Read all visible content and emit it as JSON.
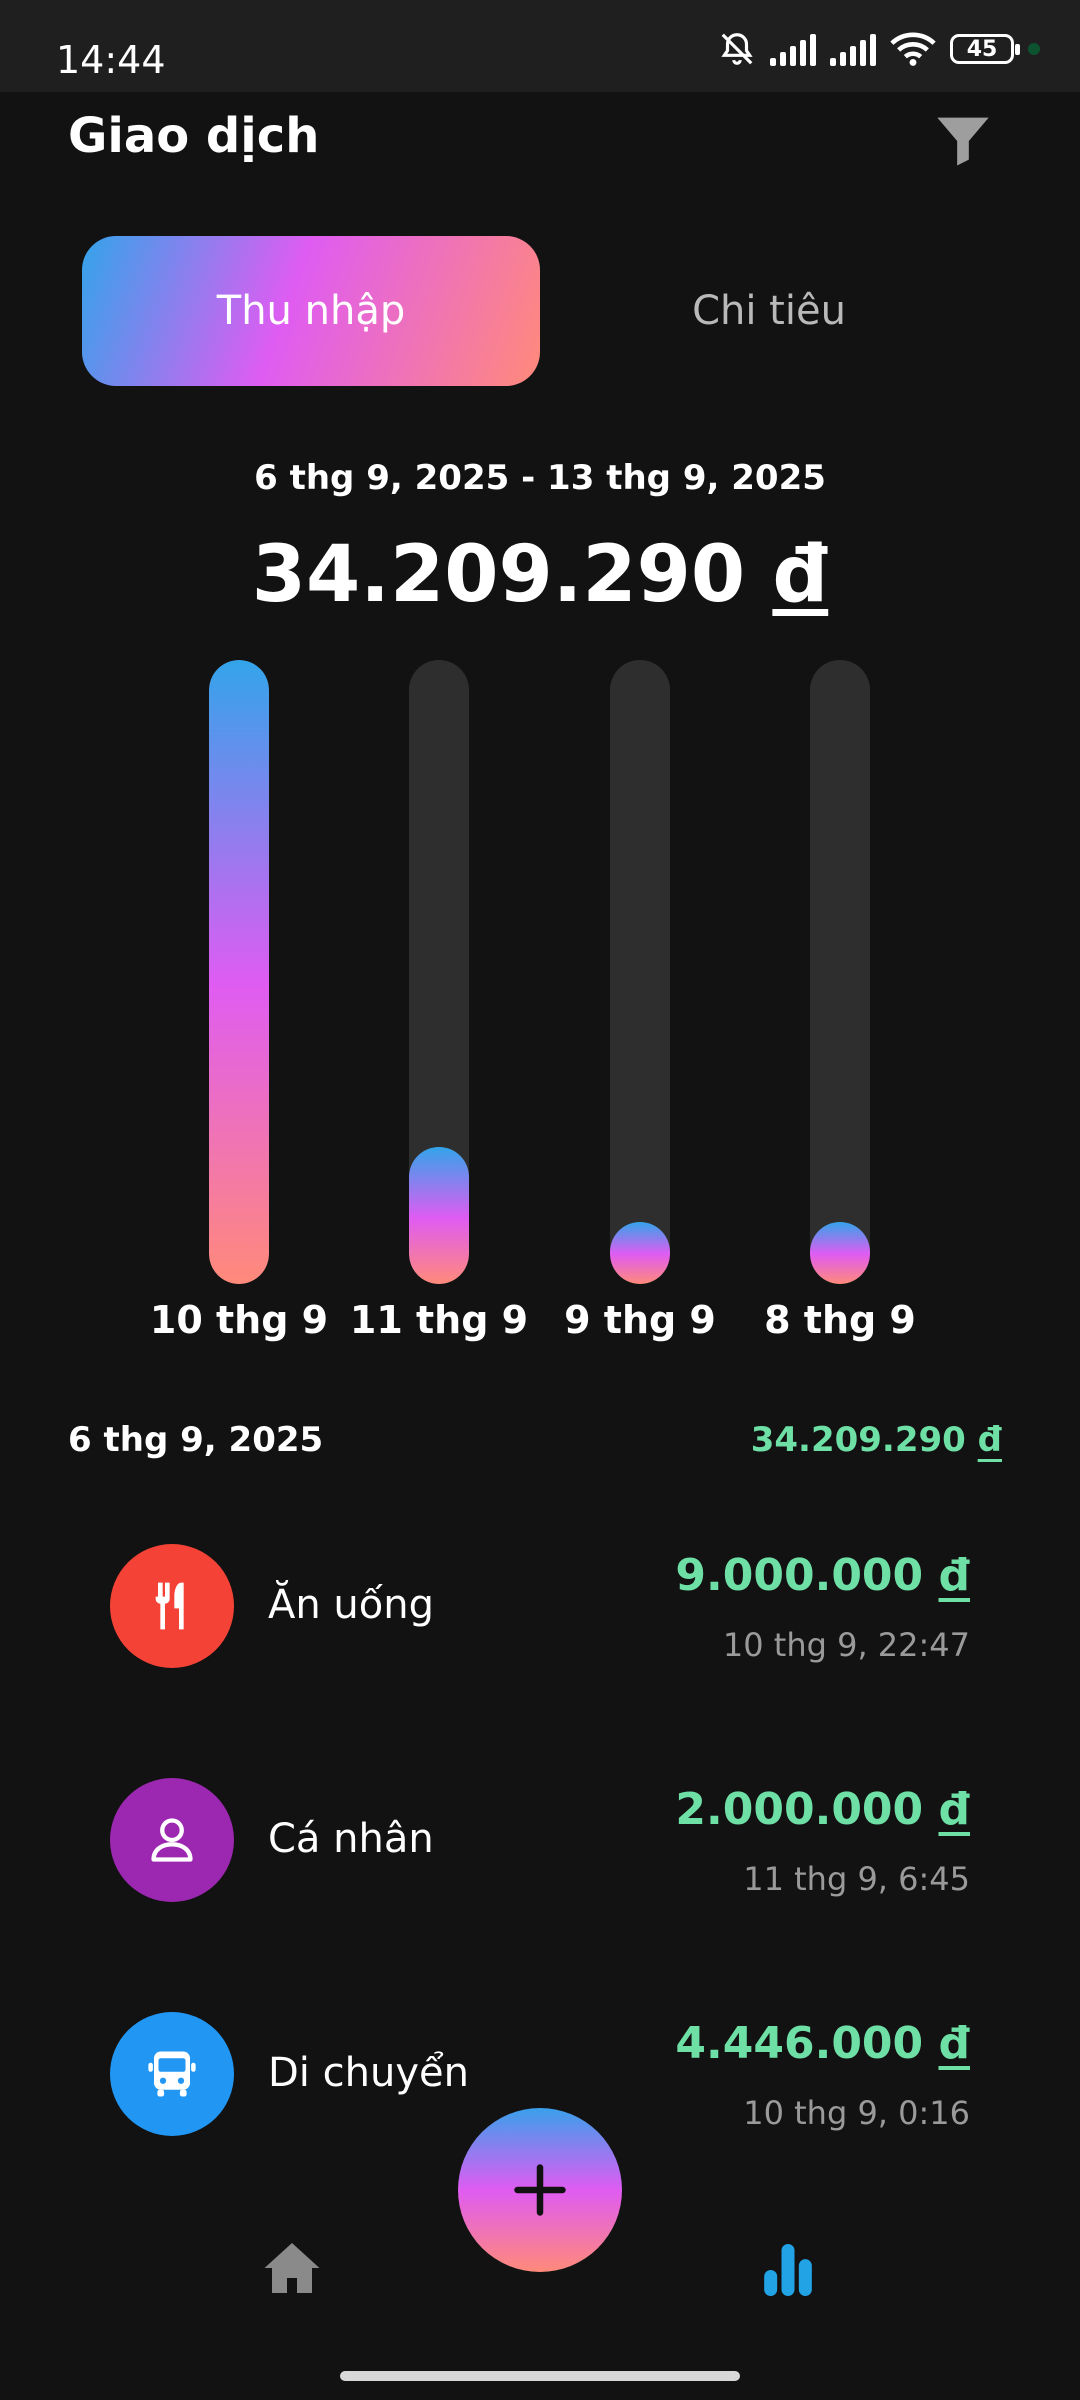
{
  "status_bar": {
    "time": "14:44",
    "battery": "45"
  },
  "header": {
    "title": "Giao dịch"
  },
  "tabs": [
    {
      "label": "Thu nhập",
      "active": true
    },
    {
      "label": "Chi tiêu",
      "active": false
    }
  ],
  "summary": {
    "date_range": "6 thg 9, 2025 - 13 thg 9, 2025",
    "total_amount": "34.209.290",
    "currency": "đ"
  },
  "chart_data": {
    "type": "bar",
    "categories": [
      "10 thg 9",
      "11 thg 9",
      "9 thg 9",
      "8 thg 9"
    ],
    "values": [
      1.0,
      0.22,
      0.1,
      0.1
    ],
    "colors": [
      "#33a4ea",
      "#df5cf2",
      "#ff8a7a"
    ]
  },
  "group": {
    "date": "6 thg 9, 2025",
    "total": "34.209.290",
    "currency": "đ"
  },
  "transactions": [
    {
      "name": "Ăn uống",
      "amount": "9.000.000",
      "currency": "đ",
      "time": "10 thg 9, 22:47",
      "icon": "fork-knife-icon",
      "color": "#f44336"
    },
    {
      "name": "Cá nhân",
      "amount": "2.000.000",
      "currency": "đ",
      "time": "11 thg 9, 6:45",
      "icon": "person-icon",
      "color": "#9c27b0"
    },
    {
      "name": "Di chuyển",
      "amount": "4.446.000",
      "currency": "đ",
      "time": "10 thg 9, 0:16",
      "icon": "bus-icon",
      "color": "#2196f3"
    }
  ],
  "bottom_nav": {
    "items": [
      "home-icon",
      "add-icon",
      "stats-icon"
    ],
    "active_color": "#21a3e6"
  },
  "colors": {
    "income": "#6ee0a6",
    "background": "#121212"
  }
}
